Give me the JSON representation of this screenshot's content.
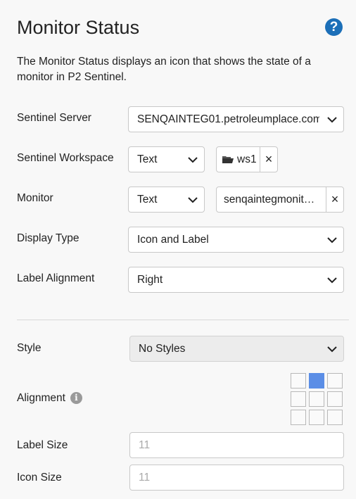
{
  "panel": {
    "title": "Monitor Status",
    "help_icon": "?",
    "description": "The Monitor Status displays an icon that shows the state of a monitor in P2 Sentinel."
  },
  "fields": {
    "sentinel_server": {
      "label": "Sentinel Server",
      "value": "SENQAINTEG01.petroleumplace.com"
    },
    "sentinel_workspace": {
      "label": "Sentinel Workspace",
      "mode": "Text",
      "chip_value": "ws1",
      "chip_close": "×"
    },
    "monitor": {
      "label": "Monitor",
      "mode": "Text",
      "chip_value": "senqaintegmonit…",
      "chip_close": "×"
    },
    "display_type": {
      "label": "Display Type",
      "value": "Icon and Label"
    },
    "label_alignment": {
      "label": "Label Alignment",
      "value": "Right"
    },
    "style": {
      "label": "Style",
      "value": "No Styles"
    },
    "alignment": {
      "label": "Alignment",
      "info_icon": "i",
      "selected_cell": "top-center"
    },
    "label_size": {
      "label": "Label Size",
      "placeholder": "11"
    },
    "icon_size": {
      "label": "Icon Size",
      "placeholder": "11"
    }
  },
  "colors": {
    "accent": "#1c6fb8",
    "selected_cell": "#5b8ee6"
  }
}
